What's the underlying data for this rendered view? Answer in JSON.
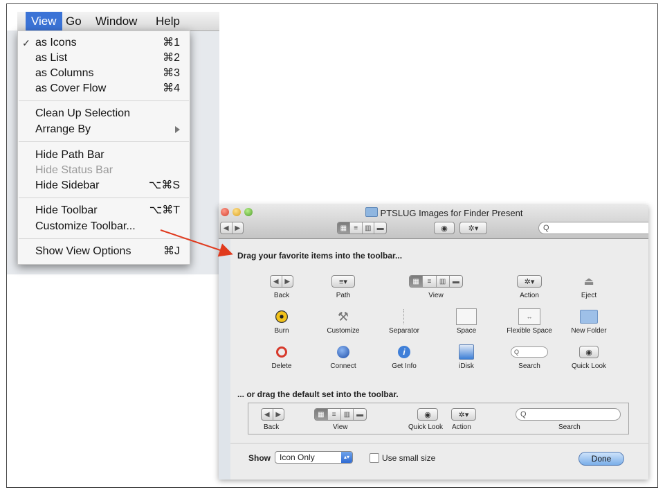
{
  "menubar": {
    "items": [
      "View",
      "Go",
      "Window",
      "Help"
    ]
  },
  "view_menu": {
    "check_mark": "✓",
    "items": [
      {
        "label": "as Icons",
        "shortcut": "⌘1"
      },
      {
        "label": "as List",
        "shortcut": "⌘2"
      },
      {
        "label": "as Columns",
        "shortcut": "⌘3"
      },
      {
        "label": "as Cover Flow",
        "shortcut": "⌘4"
      },
      {
        "label": "Clean Up Selection",
        "shortcut": ""
      },
      {
        "label": "Arrange By",
        "shortcut": ""
      },
      {
        "label": "Hide Path Bar",
        "shortcut": ""
      },
      {
        "label": "Hide Status Bar",
        "shortcut": ""
      },
      {
        "label": "Hide Sidebar",
        "shortcut": "⌥⌘S"
      },
      {
        "label": "Hide Toolbar",
        "shortcut": "⌥⌘T"
      },
      {
        "label": "Customize Toolbar...",
        "shortcut": ""
      },
      {
        "label": "Show View Options",
        "shortcut": "⌘J"
      }
    ]
  },
  "window": {
    "title": "PTSLUG Images for Finder Present",
    "toolbar": {
      "search_placeholder": "Q"
    }
  },
  "customize": {
    "heading": "Drag your favorite items into the toolbar...",
    "items": [
      "Back",
      "Path",
      "View",
      "Action",
      "Eject",
      "Burn",
      "Customize",
      "Separator",
      "Space",
      "Flexible Space",
      "New Folder",
      "Delete",
      "Connect",
      "Get Info",
      "iDisk",
      "Search",
      "Quick Look"
    ],
    "default_heading": "... or drag the default set into the toolbar.",
    "default_items": [
      "Back",
      "View",
      "Quick Look",
      "Action",
      "Search"
    ],
    "show_label": "Show",
    "show_value": "Icon Only",
    "small_size_label": "Use small size",
    "done_label": "Done"
  },
  "colors": {
    "menu_highlight": "#3b73d6",
    "arrow": "#e03a1e",
    "done_button": "#7aaee9"
  }
}
